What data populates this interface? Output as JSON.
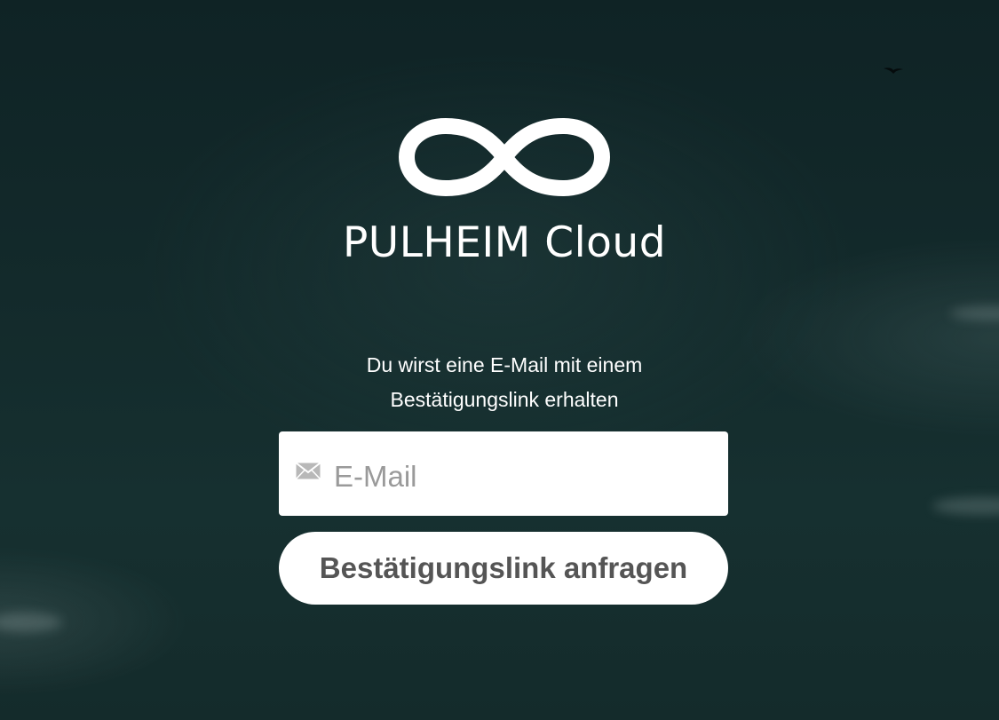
{
  "brand": {
    "name": "PULHEIM Cloud",
    "logo_icon": "infinity-icon"
  },
  "info": {
    "line1": "Du wirst eine E-Mail mit einem",
    "line2": "Bestätigungslink erhalten"
  },
  "form": {
    "email_placeholder": "E-Mail",
    "email_value": "",
    "email_icon": "mail-icon",
    "submit_label": "Bestätigungslink anfragen"
  },
  "colors": {
    "background": "#132a2b",
    "text": "#ffffff",
    "button_text": "#555555",
    "placeholder": "#9a9a9a"
  }
}
